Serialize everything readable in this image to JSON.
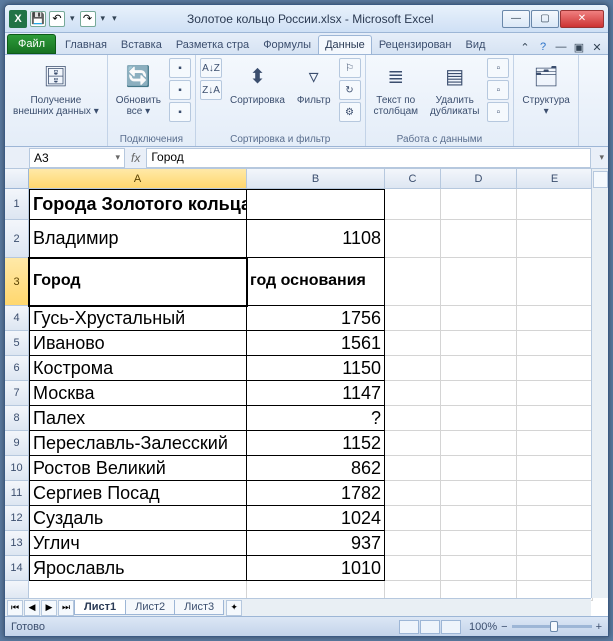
{
  "titlebar": {
    "document_name": "Золотое кольцо России.xlsx - Microsoft Excel"
  },
  "tabs": {
    "file": "Файл",
    "items": [
      "Главная",
      "Вставка",
      "Разметка стра",
      "Формулы",
      "Данные",
      "Рецензирован",
      "Вид"
    ],
    "active_index": 4
  },
  "ribbon": {
    "groups": [
      {
        "label": "",
        "buttons": [
          {
            "key": "ext",
            "label": "Получение\nвнешних данных ▾",
            "icon": "🗄"
          }
        ]
      },
      {
        "label": "Подключения",
        "buttons": [
          {
            "key": "refresh",
            "label": "Обновить\nвсе ▾",
            "icon": "🔄"
          }
        ]
      },
      {
        "label": "Сортировка и фильтр",
        "buttons": [
          {
            "key": "sortaz",
            "label": "",
            "icon": "A↓Z"
          },
          {
            "key": "sortza",
            "label": "",
            "icon": "Z↓A"
          },
          {
            "key": "sort",
            "label": "Сортировка",
            "icon": "⬍"
          },
          {
            "key": "filter",
            "label": "Фильтр",
            "icon": "▿"
          }
        ]
      },
      {
        "label": "Работа с данными",
        "buttons": [
          {
            "key": "txtcol",
            "label": "Текст по\nстолбцам",
            "icon": "≣"
          },
          {
            "key": "dedup",
            "label": "Удалить\nдубликаты",
            "icon": "▤"
          }
        ]
      },
      {
        "label": "",
        "buttons": [
          {
            "key": "struct",
            "label": "Структура\n▾",
            "icon": "🗂"
          }
        ]
      }
    ]
  },
  "namebox": {
    "ref": "A3",
    "formula": "Город",
    "fx": "fx"
  },
  "columns": [
    "A",
    "B",
    "C",
    "D",
    "E"
  ],
  "selected_col_index": 0,
  "selected_row": 3,
  "rows": [
    {
      "n": 1,
      "h": 31,
      "A": "Города Золотого кольца Poccии",
      "style": "big",
      "overflow": true,
      "dtopA": true,
      "dleftA": true,
      "brA": true,
      "brB": true
    },
    {
      "n": 2,
      "h": 38,
      "A": "Владимир",
      "B": "1108",
      "style": "body18",
      "dleftA": true,
      "brA": true,
      "brB": true
    },
    {
      "n": 3,
      "h": 48,
      "A": "Город",
      "B": "год\nоснования",
      "style": "hdr3",
      "dleftA": true,
      "brA": true,
      "brB": true,
      "selected": true
    },
    {
      "n": 4,
      "h": 25,
      "A": "Гусь-Хрустальный",
      "B": "1756",
      "style": "body18",
      "dleftA": true,
      "brA": true,
      "brB": true
    },
    {
      "n": 5,
      "h": 25,
      "A": "Иваново",
      "B": "1561",
      "style": "body18",
      "dleftA": true,
      "brA": true,
      "brB": true
    },
    {
      "n": 6,
      "h": 25,
      "A": "Кострома",
      "B": "1150",
      "style": "body18",
      "dleftA": true,
      "brA": true,
      "brB": true
    },
    {
      "n": 7,
      "h": 25,
      "A": "Москва",
      "B": "1147",
      "style": "body18",
      "dleftA": true,
      "brA": true,
      "brB": true
    },
    {
      "n": 8,
      "h": 25,
      "A": "Палех",
      "B": "?",
      "style": "body18",
      "dleftA": true,
      "brA": true,
      "brB": true
    },
    {
      "n": 9,
      "h": 25,
      "A": "Переславль-Залесский",
      "B": "1152",
      "style": "body18",
      "dleftA": true,
      "brA": true,
      "brB": true
    },
    {
      "n": 10,
      "h": 25,
      "A": "Ростов Великий",
      "B": "862",
      "style": "body18",
      "dleftA": true,
      "brA": true,
      "brB": true
    },
    {
      "n": 11,
      "h": 25,
      "A": "Сергиев Посад",
      "B": "1782",
      "style": "body18",
      "dleftA": true,
      "brA": true,
      "brB": true
    },
    {
      "n": 12,
      "h": 25,
      "A": "Суздаль",
      "B": "1024",
      "style": "body18",
      "dleftA": true,
      "brA": true,
      "brB": true
    },
    {
      "n": 13,
      "h": 25,
      "A": "Углич",
      "B": "937",
      "style": "body18",
      "dleftA": true,
      "brA": true,
      "brB": true
    },
    {
      "n": 14,
      "h": 25,
      "A": "Ярославль",
      "B": "1010",
      "style": "body18",
      "dleftA": true,
      "brA": true,
      "brB": true
    }
  ],
  "sheet_tabs": {
    "items": [
      "Лист1",
      "Лист2",
      "Лист3"
    ],
    "active": 0
  },
  "status": {
    "text": "Готово",
    "zoom": "100%",
    "zoom_minus": "−",
    "zoom_plus": "+"
  }
}
